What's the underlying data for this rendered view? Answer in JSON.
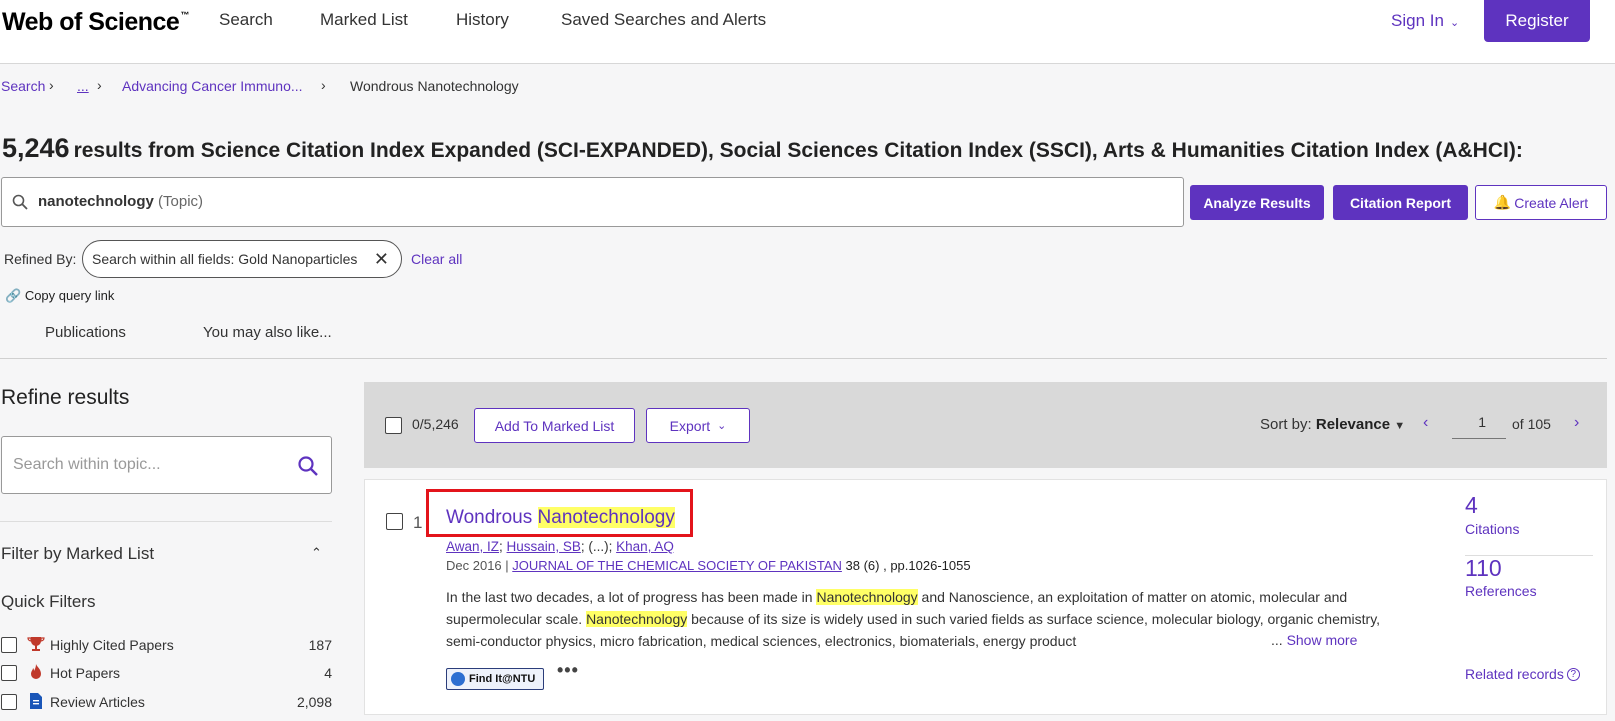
{
  "header": {
    "logo": "Web of Science",
    "logo_tm": "™",
    "nav": [
      "Search",
      "Marked List",
      "History",
      "Saved Searches and Alerts"
    ],
    "sign_in": "Sign In",
    "register": "Register"
  },
  "breadcrumb": {
    "items": [
      "Search",
      "...",
      "Advancing Cancer Immuno...",
      "Wondrous Nanotechnology"
    ]
  },
  "results": {
    "count": "5,246",
    "text": "results from Science Citation Index Expanded (SCI-EXPANDED), Social Sciences Citation Index (SSCI), Arts & Humanities Citation Index (A&HCI):"
  },
  "query": {
    "term": "nanotechnology",
    "field": "(Topic)"
  },
  "actions": {
    "analyze": "Analyze Results",
    "citation_report": "Citation Report",
    "create_alert": "Create Alert"
  },
  "refine": {
    "refined_by": "Refined By:",
    "chip": "Search within all fields: Gold Nanoparticles",
    "clear_all": "Clear all",
    "copy_link": "Copy query link"
  },
  "tabs": [
    "Publications",
    "You may also like..."
  ],
  "sidebar": {
    "title": "Refine results",
    "search_placeholder": "Search within topic...",
    "filter_marked": "Filter by Marked List",
    "quick_filters": "Quick Filters",
    "filters": [
      {
        "label": "Highly Cited Papers",
        "count": "187",
        "icon": "trophy-icon"
      },
      {
        "label": "Hot Papers",
        "count": "4",
        "icon": "flame-icon"
      },
      {
        "label": "Review Articles",
        "count": "2,098",
        "icon": "document-icon"
      }
    ]
  },
  "toolbar": {
    "selected": "0/5,246",
    "add_marked": "Add To Marked List",
    "export": "Export",
    "sort_label": "Sort by:",
    "sort_value": "Relevance",
    "page": "1",
    "of_pages": "of 105"
  },
  "record": {
    "index": "1",
    "title_pre": "Wondrous ",
    "title_hl": "Nanotechnology",
    "authors": [
      "Awan, IZ",
      "Hussain, SB",
      "Khan, AQ"
    ],
    "authors_ellipsis": "(...)",
    "date": "Dec 2016",
    "journal": "JOURNAL OF THE CHEMICAL SOCIETY OF PAKISTAN",
    "volume": "38 (6) , pp.1026-1055",
    "abstract_1": "In the last two decades, a lot of progress has been made in ",
    "abstract_hl1": "Nanotechnology",
    "abstract_2": " and Nanoscience, an exploitation of matter on atomic, molecular and supermolecular scale. ",
    "abstract_hl2": "Nanotechnology",
    "abstract_3": " because of its size is widely used in such varied fields as surface science, molecular biology, organic chemistry, semi-conductor physics, micro fabrication, medical sciences, electronics, biomaterials, energy product",
    "show_more_prefix": "...",
    "show_more": "Show more",
    "find_it": "Find It@NTU",
    "citations": "4",
    "citations_label": "Citations",
    "references": "110",
    "references_label": "References",
    "related": "Related records"
  }
}
